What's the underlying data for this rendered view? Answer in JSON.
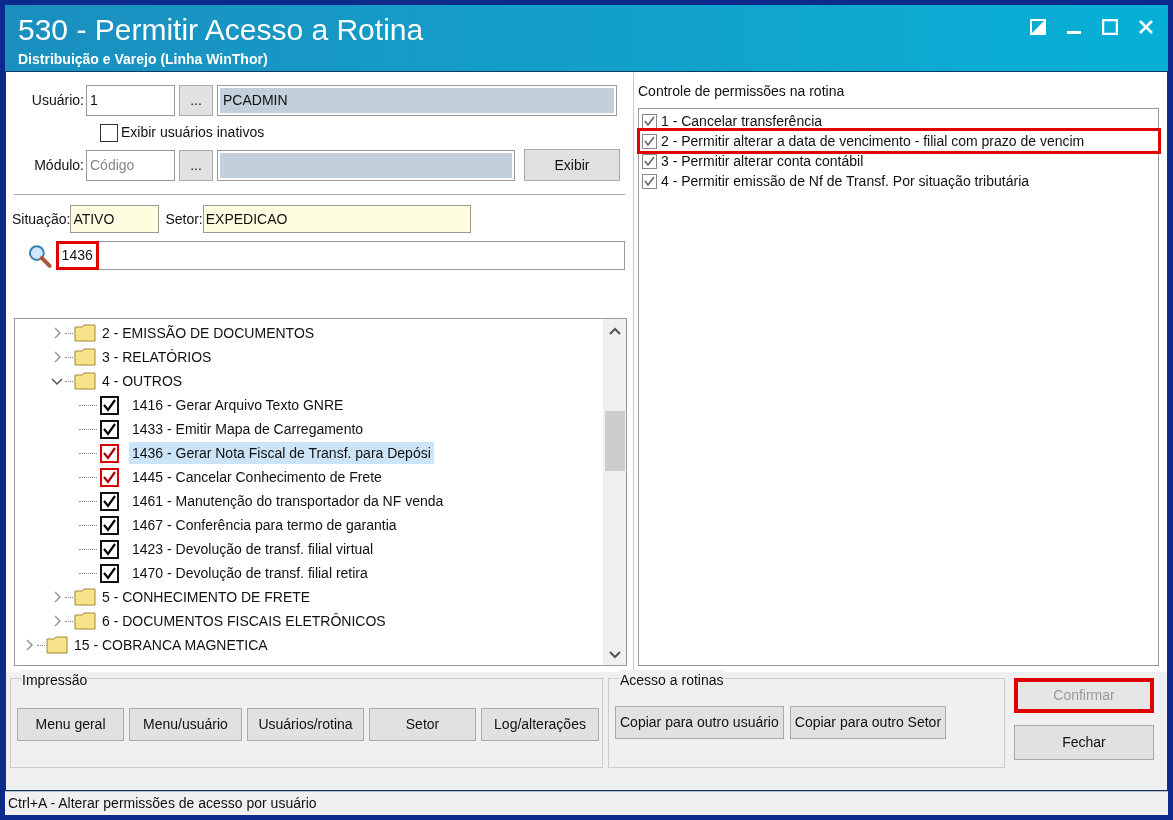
{
  "window": {
    "title": "530 - Permitir Acesso a Rotina",
    "subtitle": "Distribuição e Varejo (Linha WinThor)"
  },
  "user": {
    "label": "Usuário:",
    "code": "1",
    "lookup": "...",
    "name": "PCADMIN"
  },
  "show_inactive": {
    "label": "Exibir usuários inativos",
    "checked": false
  },
  "module": {
    "label": "Módulo:",
    "placeholder": "Código",
    "lookup": "...",
    "show_button": "Exibir"
  },
  "situation": {
    "label": "Situação:",
    "value": "ATIVO"
  },
  "sector": {
    "label": "Setor:",
    "value": "EXPEDICAO"
  },
  "search": {
    "value": "1436",
    "highlighted": true
  },
  "tree": {
    "items": [
      {
        "children": [
          {
            "label": "2 - EMISSÃO DE DOCUMENTOS",
            "expanded": false
          },
          {
            "label": "3 - RELATÓRIOS",
            "expanded": false
          },
          {
            "label": "4 - OUTROS",
            "expanded": true,
            "children": [
              {
                "label": "1416 - Gerar Arquivo Texto GNRE",
                "checked": true,
                "modified": false,
                "selected": false
              },
              {
                "label": "1433 - Emitir Mapa de Carregamento",
                "checked": true,
                "modified": false,
                "selected": false
              },
              {
                "label": "1436 - Gerar Nota Fiscal de Transf. para Depósi",
                "checked": true,
                "modified": true,
                "selected": true
              },
              {
                "label": "1445 - Cancelar Conhecimento de Frete",
                "checked": true,
                "modified": true,
                "selected": false
              },
              {
                "label": "1461 - Manutenção do transportador da NF venda",
                "checked": true,
                "modified": false,
                "selected": false
              },
              {
                "label": "1467 - Conferência para termo de garantia",
                "checked": true,
                "modified": false,
                "selected": false
              },
              {
                "label": "1423 - Devolução de transf. filial virtual",
                "checked": true,
                "modified": false,
                "selected": false
              },
              {
                "label": "1470 - Devolução de transf. filial retira",
                "checked": true,
                "modified": false,
                "selected": false
              }
            ]
          },
          {
            "label": "5 - CONHECIMENTO DE FRETE",
            "expanded": false
          },
          {
            "label": "6 - DOCUMENTOS FISCAIS ELETRÔNICOS",
            "expanded": false
          }
        ]
      },
      {
        "label": "15 - COBRANCA MAGNETICA",
        "expanded": false
      }
    ]
  },
  "permissions": {
    "title": "Controle de permissões na rotina",
    "items": [
      {
        "label": "1 - Cancelar transferência",
        "checked": true,
        "highlighted": false
      },
      {
        "label": "2 - Permitir alterar a data de vencimento - filial com prazo de vencim",
        "checked": true,
        "highlighted": true
      },
      {
        "label": "3 - Permitir alterar conta contábil",
        "checked": true,
        "highlighted": false
      },
      {
        "label": "4 - Permitir emissão de Nf de Transf. Por situação tributária",
        "checked": true,
        "highlighted": false
      }
    ]
  },
  "print_group": {
    "title": "Impressão",
    "buttons": [
      "Menu geral",
      "Menu/usuário",
      "Usuários/rotina",
      "Setor",
      "Log/alterações"
    ]
  },
  "access_group": {
    "title": "Acesso a rotinas",
    "buttons": [
      "Copiar para outro usuário",
      "Copiar para outro Setor"
    ]
  },
  "actions": [
    {
      "label": "Confirmar",
      "disabled": true,
      "highlighted": true
    },
    {
      "label": "Fechar",
      "disabled": false,
      "highlighted": false
    }
  ],
  "status_bar": "Ctrl+A - Alterar permissões de acesso por usuário"
}
